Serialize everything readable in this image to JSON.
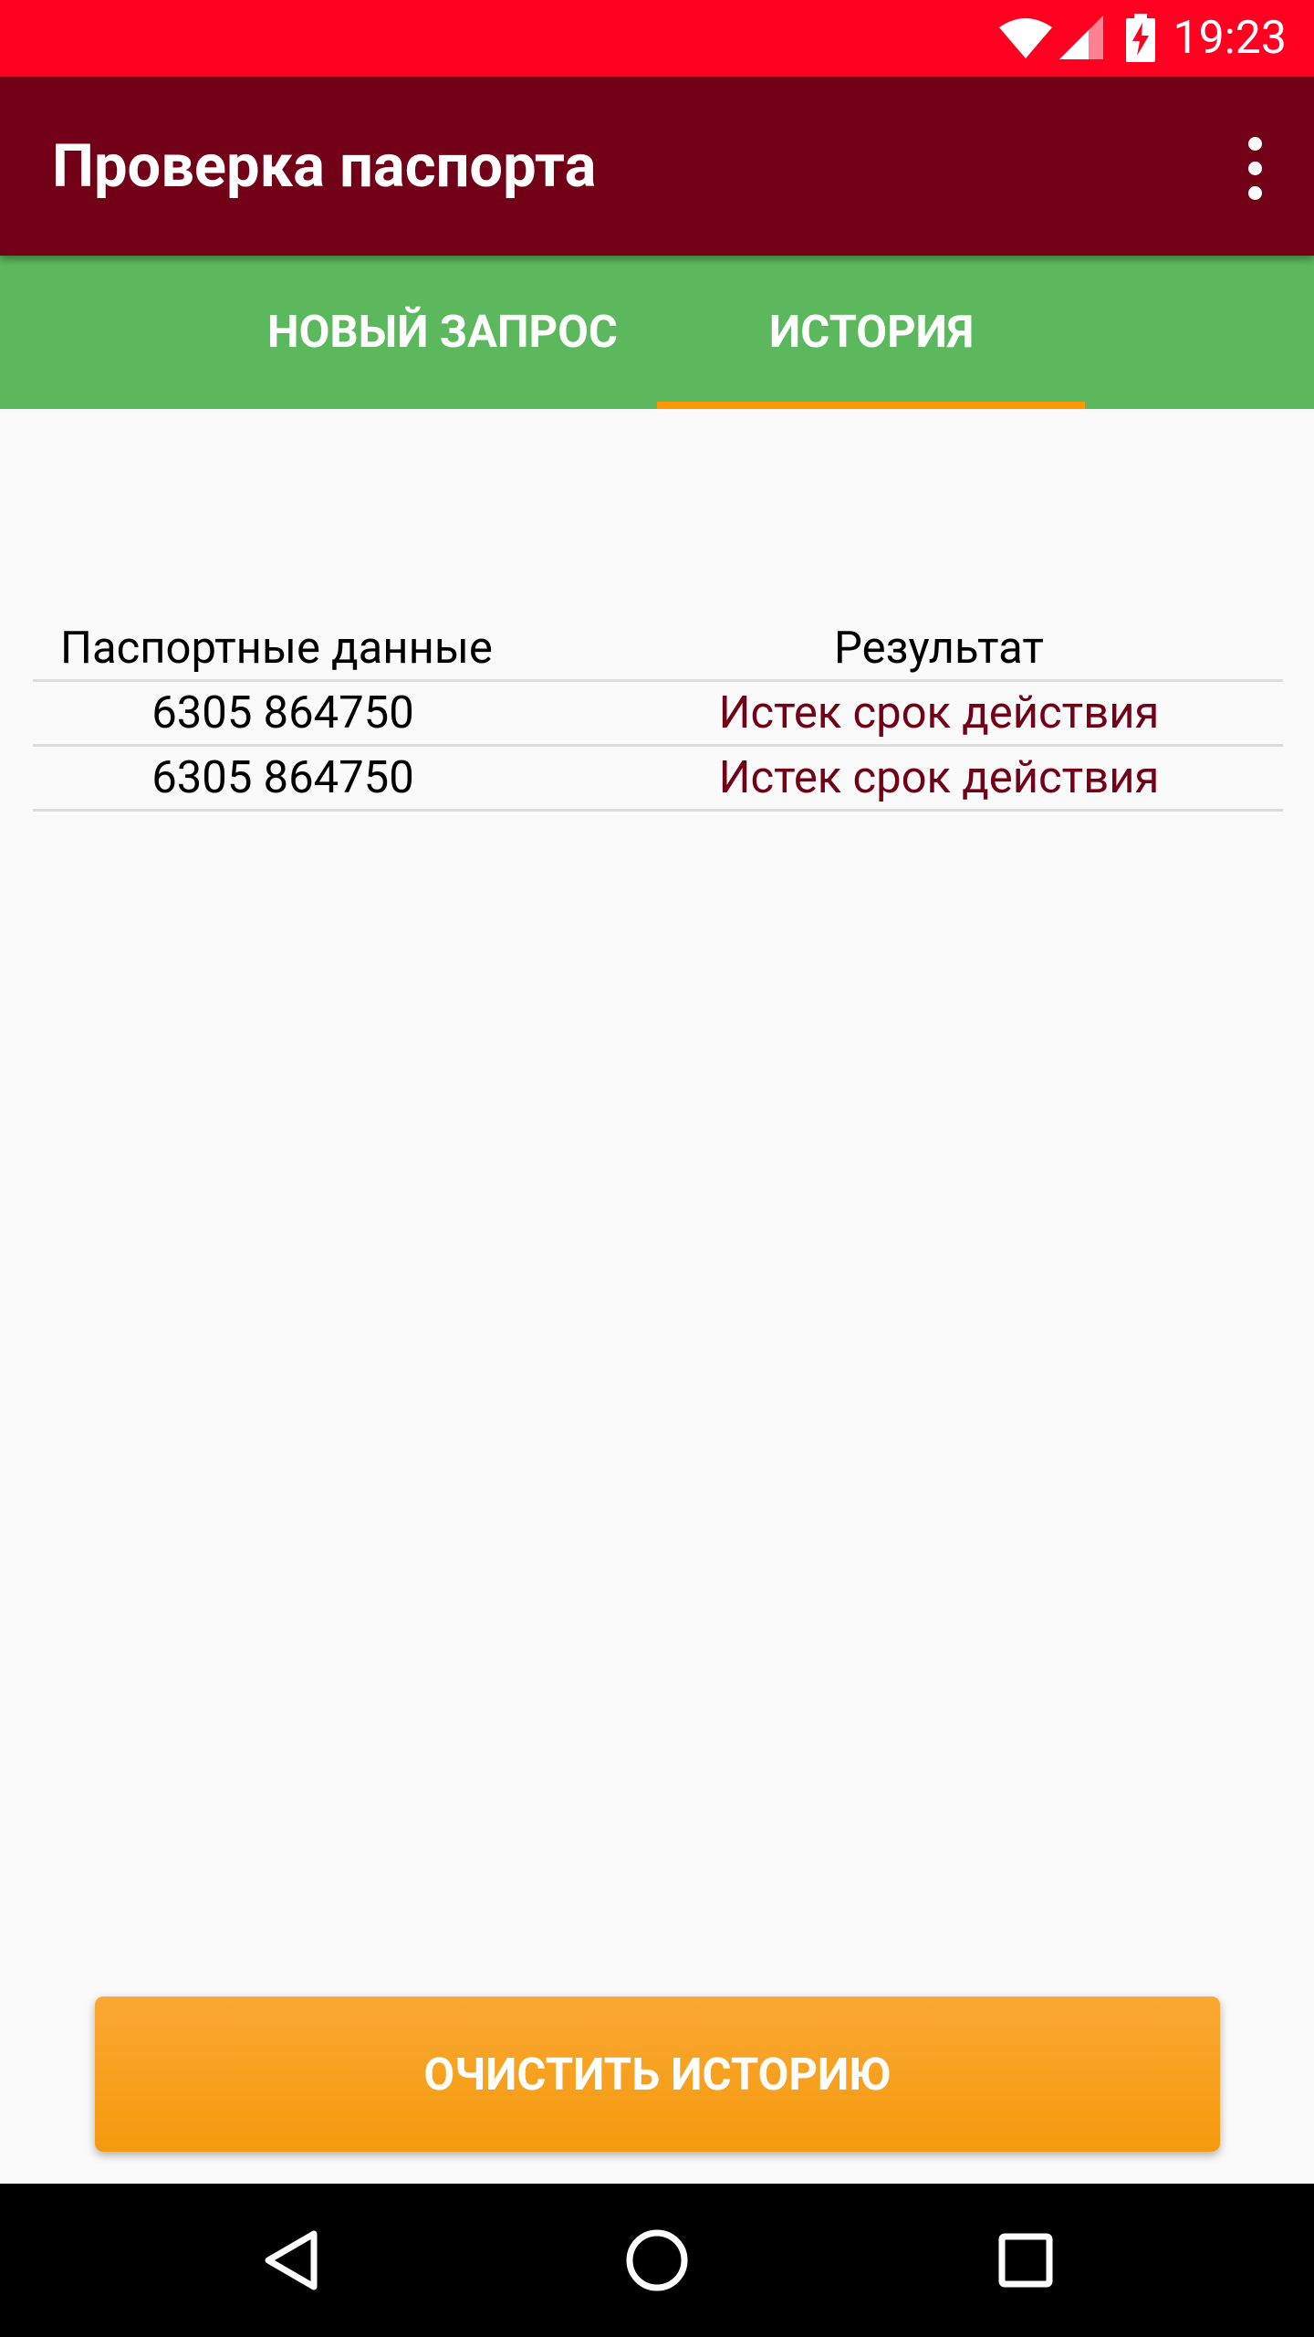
{
  "status_bar": {
    "time": "19:23",
    "icons": [
      "wifi-icon",
      "signal-icon",
      "battery-charging-icon"
    ]
  },
  "app_bar": {
    "title": "Проверка паспорта",
    "menu_icon": "overflow-menu-icon"
  },
  "tabs": [
    {
      "label": "НОВЫЙ ЗАПРОС",
      "selected": false
    },
    {
      "label": "ИСТОРИЯ",
      "selected": true
    }
  ],
  "history_table": {
    "headers": [
      "Паспортные данные",
      "Результат"
    ],
    "rows": [
      {
        "passport": "6305 864750",
        "result": "Истек срок действия"
      },
      {
        "passport": "6305 864750",
        "result": "Истек срок действия"
      }
    ]
  },
  "clear_button": {
    "label": "ОЧИСТИТЬ ИСТОРИЮ"
  },
  "nav_bar": {
    "icons": [
      "back-icon",
      "home-icon",
      "recents-icon"
    ]
  },
  "colors": {
    "status_bar": "#ff0020",
    "app_bar": "#720017",
    "tab_bar": "#5cb85c",
    "tab_indicator": "#ff9800",
    "result_text": "#720017",
    "button": "#f8a020"
  }
}
